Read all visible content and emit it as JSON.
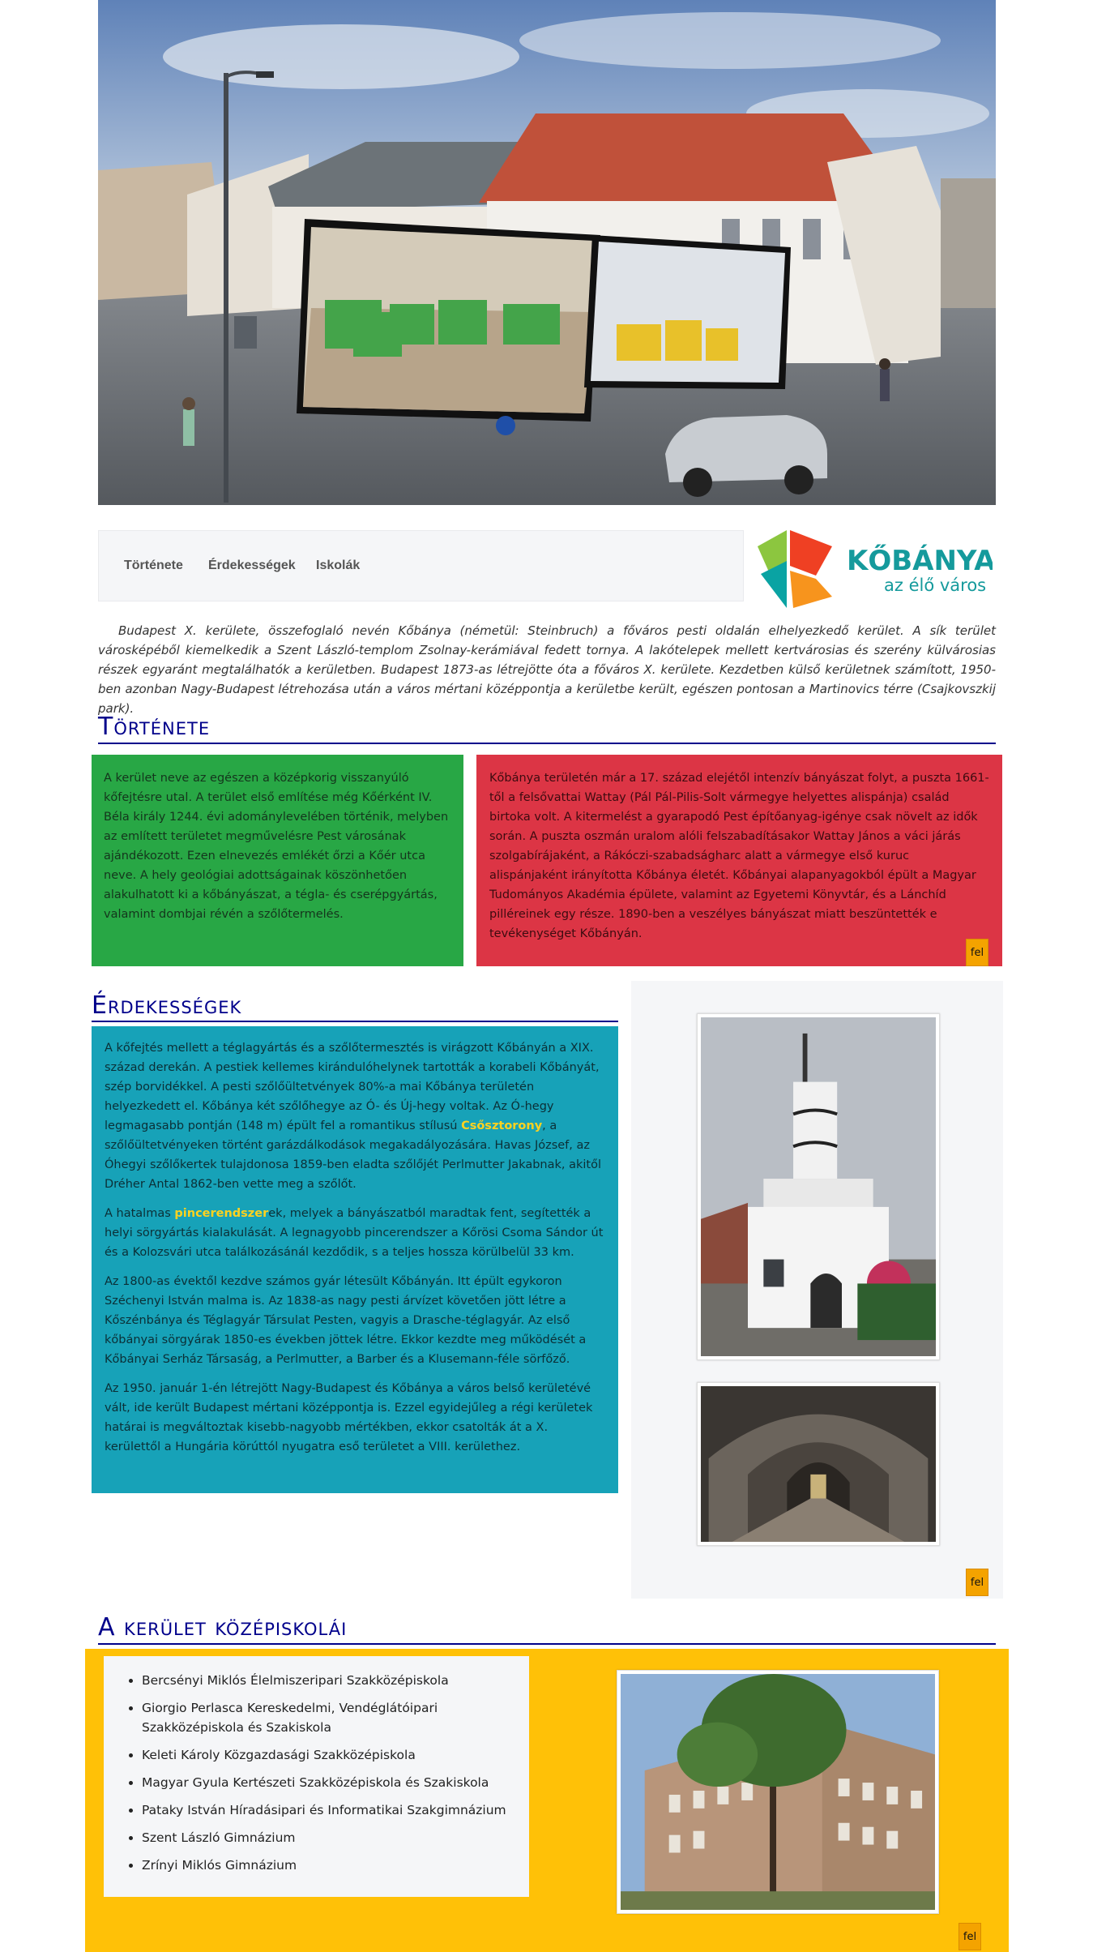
{
  "nav": {
    "items": [
      "Története",
      "Érdekességek",
      "Iskolák"
    ]
  },
  "logo": {
    "name": "KŐBÁNYA",
    "tagline": "az élő város"
  },
  "intro": "Budapest X. kerülete, összefoglaló nevén Kőbánya (németül: Steinbruch) a főváros pesti oldalán elhelyezkedő kerület. A sík terület városképéből kiemelkedik a Szent László-templom Zsolnay-kerámiával fedett tornya. A lakótelepek mellett kertvárosias és szerény külvárosias részek egyaránt megtalálhatók a kerületben. Budapest 1873-as létrejötte óta a főváros X. kerülete. Kezdetben külső kerületnek számított, 1950-ben azonban Nagy-Budapest létrehozása után a város mértani középpontja a kerületbe került, egészen pontosan a Martinovics térre (Csajkovszkij park).",
  "history": {
    "title": "Története",
    "left_text": "A kerület neve az egészen a középkorig visszanyúló kőfejtésre utal. A terület első említése még Kőérként IV. Béla király 1244. évi adománylevelében történik, melyben az említett területet megművelésre Pest városának ajándékozott. Ezen elnevezés emlékét őrzi a Kőér utca neve. A hely geológiai adottságainak köszönhetően alakulhatott ki a kőbányászat, a tégla- és cserépgyártás, valamint dombjai révén a szőlőtermelés.",
    "right_text": "Kőbánya területén már a 17. század elejétől intenzív bányászat folyt, a puszta 1661-től a felsővattai Wattay (Pál Pál-Pilis-Solt vármegye helyettes alispánja) család birtoka volt. A kitermelést a gyarapodó Pest építőanyag-igénye csak növelt az idők során. A puszta oszmán uralom alóli felszabadításakor Wattay János a váci járás szolgabírájaként, a Rákóczi-szabadságharc alatt a vármegye első kuruc alispánjaként irányította Kőbánya életét. Kőbányai alapanyagokból épült a Magyar Tudományos Akadémia épülete, valamint az Egyetemi Könyvtár, és a Lánchíd pilléreinek egy része. 1890-ben a veszélyes bányászat miatt beszüntették e tevékenységet Kőbányán."
  },
  "interesting": {
    "title": "Érdekességek",
    "p1_a": "A kőfejtés mellett a téglagyártás és a szőlőtermesztés is virágzott Kőbányán a XIX. század derekán. A pestiek kellemes kirándulóhelynek tartották a korabeli Kőbányát, szép borvidékkel. A pesti szőlőültetvények 80%-a mai Kőbánya területén helyezkedett el. Kőbánya két szőlőhegye az Ó- és Új-hegy voltak. Az Ó-hegy legmagasabb pontján (148 m) épült fel a romantikus stílusú ",
    "p1_link": "Csősztorony",
    "p1_b": ", a szőlőültetvényeken történt garázdálkodások megakadályozására. Havas József, az Óhegyi szőlőkertek tulajdonosa 1859-ben eladta szőlőjét Perlmutter Jakabnak, akitől Dréher Antal 1862-ben vette meg a szőlőt.",
    "p2_a": "A hatalmas ",
    "p2_link": "pincerendszer",
    "p2_b": "ek, melyek a bányászatból maradtak fent, segítették a helyi sörgyártás kialakulását. A legnagyobb pincerendszer a Kőrösi Csoma Sándor út és a Kolozsvári utca találkozásánál kezdődik, s a teljes hossza körülbelül 33 km.",
    "p3": "Az 1800-as évektől kezdve számos gyár létesült Kőbányán. Itt épült egykoron Széchenyi István malma is. Az 1838-as nagy pesti árvízet követően jött létre a Kőszénbánya és Téglagyár Társulat Pesten, vagyis a Drasche-téglagyár. Az első kőbányai sörgyárak 1850-es években jöttek létre. Ekkor kezdte meg működését a Kőbányai Serház Társaság, a Perlmutter, a Barber és a Klusemann-féle sörfőző.",
    "p4": "Az 1950. január 1-én létrejött Nagy-Budapest és Kőbánya a város belső kerületévé vált, ide került Budapest mértani középpontja is. Ezzel egyidejűleg a régi kerületek határai is megváltoztak kisebb-nagyobb mértékben, ekkor csatolták át a X. kerülettől a Hungária körúttól nyugatra eső területet a VIII. kerülethez."
  },
  "schools": {
    "title": "A kerület középiskolái",
    "items": [
      "Bercsényi Miklós Élelmiszeripari Szakközépiskola",
      "Giorgio Perlasca Kereskedelmi, Vendéglátóipari Szakközépiskola és Szakiskola",
      "Keleti Károly Közgazdasági Szakközépiskola",
      "Magyar Gyula Kertészeti Szakközépiskola és Szakiskola",
      "Pataky István Híradásipari és Informatikai Szakgimnázium",
      "Szent László Gimnázium",
      "Zrínyi Miklós Gimnázium"
    ]
  },
  "fel_label": "fel",
  "colors": {
    "green": "#28a745",
    "red": "#dc3545",
    "teal": "#17a2b8",
    "yellow": "#ffc107",
    "heading": "#00008b",
    "fel": "#f4a300"
  }
}
